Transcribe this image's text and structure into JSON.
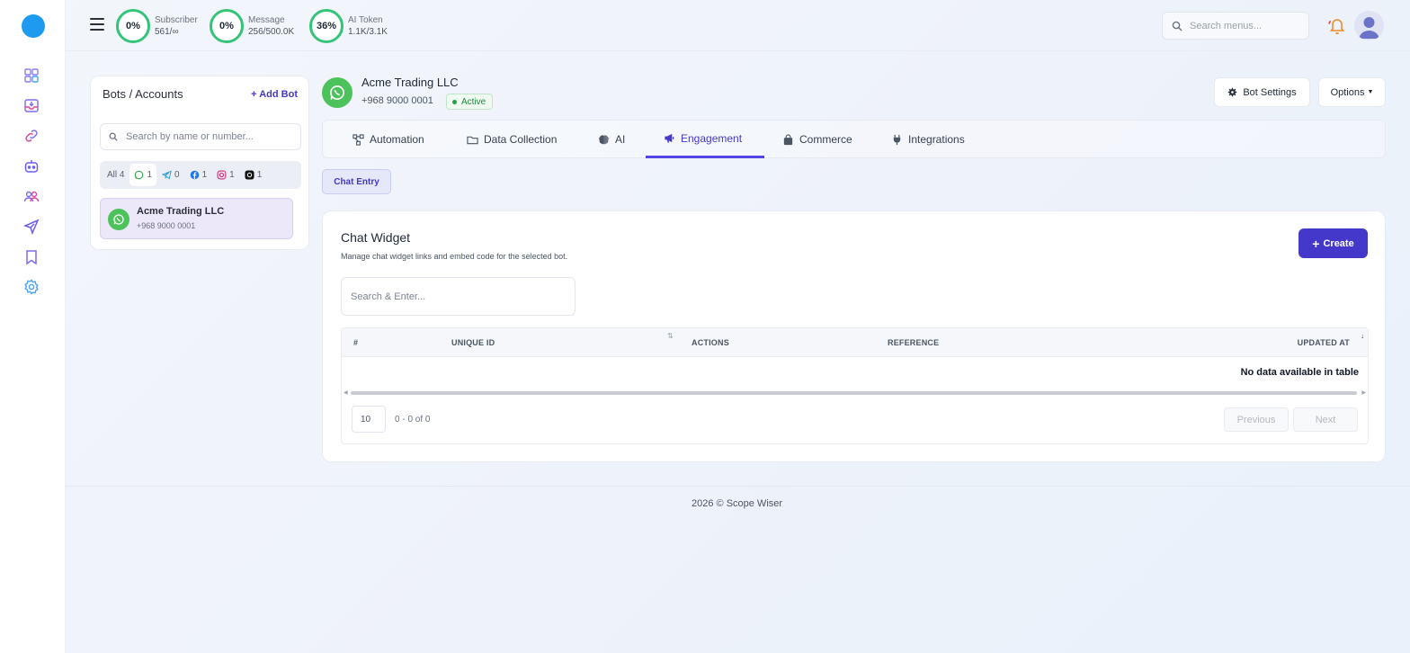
{
  "topbar": {
    "stats": [
      {
        "percent": "0%",
        "label": "Subscriber",
        "value": "561/∞",
        "fraction": 0
      },
      {
        "percent": "0%",
        "label": "Message",
        "value": "256/500.0K",
        "fraction": 0
      },
      {
        "percent": "36%",
        "label": "AI Token",
        "value": "1.1K/3.1K",
        "fraction": 0.36
      }
    ],
    "search_placeholder": "Search menus..."
  },
  "sidebar": {
    "icons": [
      "dashboard-icon",
      "inbox-icon",
      "link-icon",
      "bot-icon",
      "users-icon",
      "send-icon",
      "bookmark-icon",
      "settings-icon"
    ]
  },
  "bots_panel": {
    "title": "Bots / Accounts",
    "add_label": "+ Add Bot",
    "search_placeholder": "Search by name or number...",
    "filters": [
      {
        "label": "All",
        "count": "4"
      },
      {
        "icon": "whatsapp-icon",
        "count": "1"
      },
      {
        "icon": "telegram-icon",
        "count": "0"
      },
      {
        "icon": "facebook-icon",
        "count": "1"
      },
      {
        "icon": "instagram-icon",
        "count": "1"
      },
      {
        "icon": "threads-icon",
        "count": "1"
      }
    ],
    "items": [
      {
        "name": "Acme Trading LLC",
        "number": "+968 9000 0001"
      }
    ]
  },
  "header": {
    "bot_name": "Acme Trading LLC",
    "bot_number": "+968 9000 0001",
    "status": "Active",
    "settings_label": "Bot Settings",
    "options_label": "Options"
  },
  "tabs": [
    {
      "label": "Automation",
      "icon": "flow-icon"
    },
    {
      "label": "Data Collection",
      "icon": "folder-icon"
    },
    {
      "label": "AI",
      "icon": "brain-icon"
    },
    {
      "label": "Engagement",
      "icon": "megaphone-icon",
      "active": true
    },
    {
      "label": "Commerce",
      "icon": "bag-icon"
    },
    {
      "label": "Integrations",
      "icon": "plug-icon"
    }
  ],
  "subtab": {
    "label": "Chat Entry"
  },
  "card": {
    "title": "Chat Widget",
    "subtitle": "Manage chat widget links and embed code for the selected bot.",
    "create_label": "Create",
    "search_placeholder": "Search & Enter...",
    "columns": [
      "#",
      "UNIQUE ID",
      "ACTIONS",
      "REFERENCE",
      "UPDATED AT"
    ],
    "empty_text": "No data available in table",
    "page_size": "10",
    "page_info": "0 - 0 of 0",
    "prev_label": "Previous",
    "next_label": "Next"
  },
  "footer": {
    "text": "2026 © Scope Wiser"
  },
  "colors": {
    "accent": "#4338ca",
    "ring": "#34c477",
    "whatsapp": "#4cc25a",
    "brand_dot": "#1e9bf0"
  }
}
